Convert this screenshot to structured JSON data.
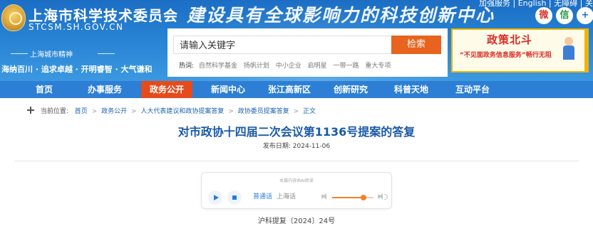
{
  "header": {
    "site_title": "上海市科学技术委员会",
    "site_domain": "STCSM.SH.GOV.CN",
    "slogan_art": "建设具有全球影响力的科技创新中心",
    "top_links": "加强服务 | English | 无障碍 | 关怀版",
    "spirit_label": "上海城市精神",
    "spirit_text": "海纳百川 · 追求卓越 · 开明睿智 · 大气谦和",
    "social": [
      {
        "icon": "weibo-icon",
        "glyph": "微"
      },
      {
        "icon": "wechat-icon",
        "glyph": "信"
      },
      {
        "icon": "more-icon",
        "glyph": "+"
      }
    ]
  },
  "search": {
    "placeholder": "请输入关键字",
    "button_label": "检索",
    "hot_label": "热词:",
    "hot_words": [
      "自然科学基金",
      "扬帆计划",
      "中小企业",
      "启明星",
      "一带一路",
      "重大专项"
    ]
  },
  "ad": {
    "title": "政策北斗",
    "subtitle": "“不见面政务信息服务”畅行无阻"
  },
  "nav": {
    "items": [
      "首页",
      "办事服务",
      "政务公开",
      "新闻中心",
      "张江高新区",
      "创新研究",
      "科普天地",
      "互动平台"
    ],
    "active_index": 2
  },
  "breadcrumb": {
    "label": "当前位置:",
    "items": [
      "首页",
      "政务公开",
      "人大代表建议和政协提案答复",
      "政协委员提案答复",
      "正文"
    ],
    "separator": ">"
  },
  "article": {
    "title": "对市政协十四届二次会议第1136号提案的答复",
    "pubdate": "发布日期: 2024-11-06",
    "doc_number": "沪科提复〔2024〕24号"
  },
  "player": {
    "tip": "本篇内容由AI朗读",
    "language_mandarin": "普通话",
    "language_shanghai": "上海话",
    "volume": 0.75
  },
  "colors": {
    "header_blue": "#2a86d6",
    "nav_blue": "#2c7fd4",
    "nav_active": "#e64b1c",
    "search_button": "#e8631d",
    "title_blue": "#1a5aa8",
    "volume_orange": "#f0822a"
  }
}
